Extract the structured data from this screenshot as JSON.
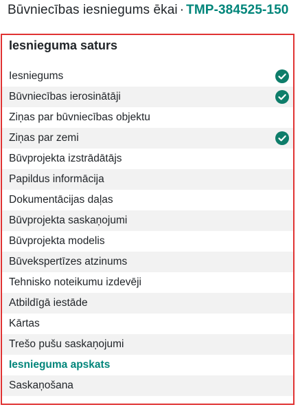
{
  "header": {
    "title": "Būvniecības iesniegums ēkai",
    "separator": "·",
    "code": "TMP-384525-150"
  },
  "panel": {
    "title": "Iesnieguma saturs"
  },
  "colors": {
    "accent": "#00857a",
    "highlight_border": "#e03232",
    "check": "#0e7d6a",
    "row_alt": "#f2f2f2"
  },
  "items": [
    {
      "label": "Iesniegums",
      "completed": true,
      "active": false,
      "icon": "check-circle-icon"
    },
    {
      "label": "Būvniecības ierosinātāji",
      "completed": true,
      "active": false,
      "icon": "check-circle-icon"
    },
    {
      "label": "Ziņas par būvniecības objektu",
      "completed": false,
      "active": false
    },
    {
      "label": "Ziņas par zemi",
      "completed": true,
      "active": false,
      "icon": "check-circle-icon"
    },
    {
      "label": "Būvprojekta izstrādātājs",
      "completed": false,
      "active": false
    },
    {
      "label": "Papildus informācija",
      "completed": false,
      "active": false
    },
    {
      "label": "Dokumentācijas daļas",
      "completed": false,
      "active": false
    },
    {
      "label": "Būvprojekta saskaņojumi",
      "completed": false,
      "active": false
    },
    {
      "label": "Būvprojekta modelis",
      "completed": false,
      "active": false
    },
    {
      "label": "Būvekspertīzes atzinums",
      "completed": false,
      "active": false
    },
    {
      "label": "Tehnisko noteikumu izdevēji",
      "completed": false,
      "active": false
    },
    {
      "label": "Atbildīgā iestāde",
      "completed": false,
      "active": false
    },
    {
      "label": "Kārtas",
      "completed": false,
      "active": false
    },
    {
      "label": "Trešo pušu saskaņojumi",
      "completed": false,
      "active": false
    },
    {
      "label": "Iesnieguma apskats",
      "completed": false,
      "active": true
    },
    {
      "label": "Saskaņošana",
      "completed": false,
      "active": false
    }
  ]
}
